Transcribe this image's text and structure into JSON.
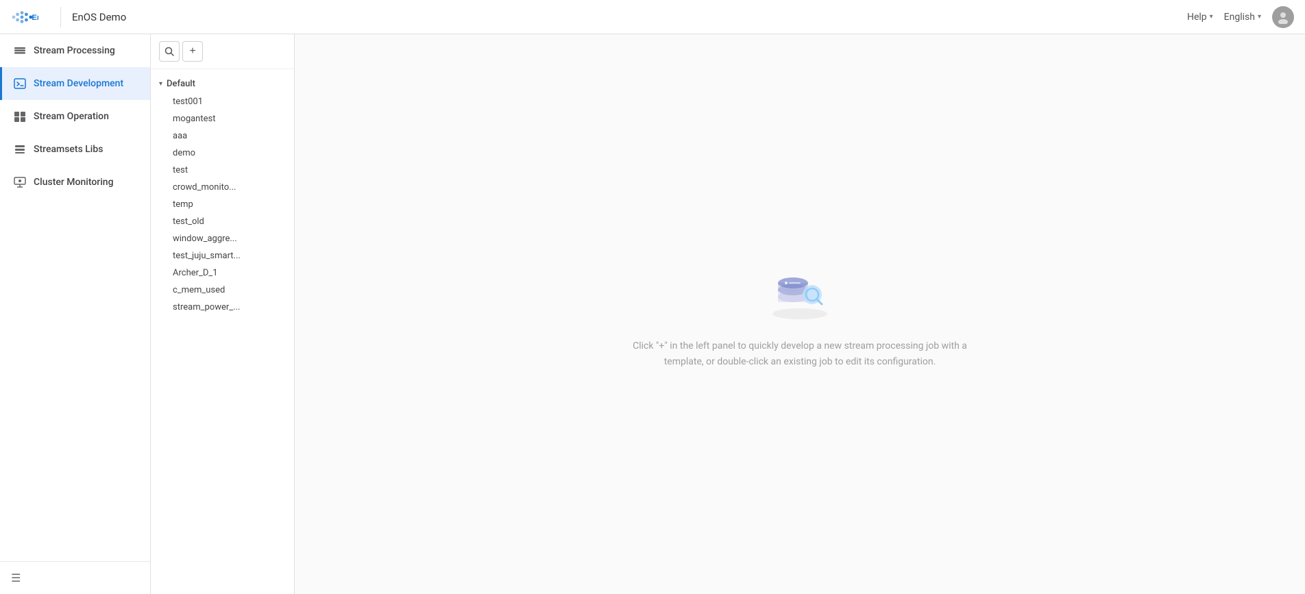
{
  "navbar": {
    "logo_alt": "EnOS",
    "logo_text": "EnOS",
    "app_name": "EnOS Demo",
    "help_label": "Help",
    "lang_label": "English",
    "avatar_char": "👤"
  },
  "sidebar": {
    "items": [
      {
        "id": "stream-processing",
        "label": "Stream Processing",
        "icon": "stream-processing-icon",
        "active": false
      },
      {
        "id": "stream-development",
        "label": "Stream Development",
        "icon": "stream-development-icon",
        "active": true
      },
      {
        "id": "stream-operation",
        "label": "Stream Operation",
        "icon": "stream-operation-icon",
        "active": false
      },
      {
        "id": "streamsets-libs",
        "label": "Streamsets Libs",
        "icon": "streamsets-libs-icon",
        "active": false
      },
      {
        "id": "cluster-monitoring",
        "label": "Cluster Monitoring",
        "icon": "cluster-monitoring-icon",
        "active": false
      }
    ],
    "collapse_label": "Collapse"
  },
  "tree": {
    "search_placeholder": "Search",
    "add_label": "+",
    "group": {
      "name": "Default",
      "expanded": true,
      "items": [
        "test001",
        "mogantest",
        "aaa",
        "demo",
        "test",
        "crowd_monito...",
        "temp",
        "test_old",
        "window_aggre...",
        "test_juju_smart...",
        "Archer_D_1",
        "c_mem_used",
        "stream_power_..."
      ]
    }
  },
  "empty_state": {
    "text": "Click \"+\" in the left panel to quickly develop a new stream processing job with a template, or double-click an existing job to edit its configuration."
  },
  "colors": {
    "primary": "#1976d2",
    "active_bg": "#e8f0fe",
    "border": "#e0e0e0"
  }
}
